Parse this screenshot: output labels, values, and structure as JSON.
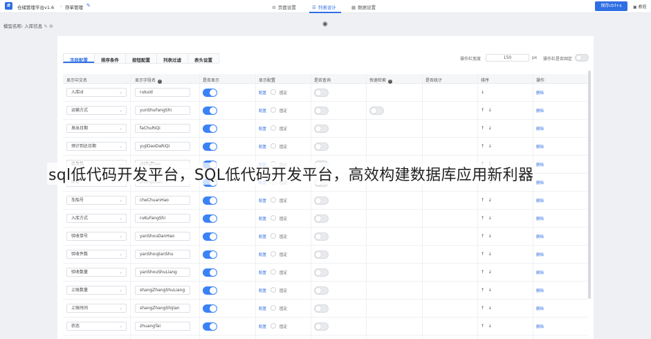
{
  "topbar": {
    "app_title": "仓储管理平台v1.6",
    "separator": "›",
    "page": "存单管理",
    "tabs": [
      {
        "label": "页面设置",
        "icon": "⚙"
      },
      {
        "label": "列表设计",
        "icon": "☰"
      },
      {
        "label": "数据设置",
        "icon": "▦"
      }
    ],
    "save_label": "保存ctrl+s",
    "help_label": "教程"
  },
  "subbar": {
    "model_label": "模型名称: 入库信息"
  },
  "config_tabs": [
    "字段配置",
    "排序条件",
    "按钮配置",
    "列表过滤",
    "表头设置"
  ],
  "options": {
    "width_label": "操作栏宽度",
    "width_value": "150",
    "unit": "px",
    "fixed_label": "操作栏是否固定"
  },
  "table": {
    "headers": [
      "显示中文名",
      "显示字段名",
      "是否显示",
      "显示配置",
      "是否查询",
      "快速检索",
      "是否统计",
      "排序",
      "操作"
    ],
    "config_link": "配置",
    "fixed_label": "固定",
    "delete_label": "删除",
    "rows": [
      {
        "cn": "入库id",
        "field": "rukuid",
        "show": true,
        "query": false,
        "quick": null,
        "arrows": "↓"
      },
      {
        "cn": "运输方式",
        "field": "yunShuFangShi",
        "show": true,
        "query": false,
        "quick": false,
        "arrows": "↑↓"
      },
      {
        "cn": "发出日期",
        "field": "faChuRiQi",
        "show": true,
        "query": false,
        "quick": null,
        "arrows": "↑↓"
      },
      {
        "cn": "预计到达日期",
        "field": "yuJiDaoDaRiQi",
        "show": true,
        "query": false,
        "quick": null,
        "arrows": "↑↓"
      },
      {
        "cn": "始发站",
        "field": "shiFaZhan",
        "show": true,
        "query": false,
        "quick": null,
        "arrows": "↑↓"
      },
      {
        "cn": "终点",
        "field": "zhongDian",
        "show": true,
        "query": false,
        "quick": null,
        "arrows": "↑↓"
      },
      {
        "cn": "车船号",
        "field": "cheChuanHao",
        "show": true,
        "query": false,
        "quick": null,
        "arrows": "↑↓"
      },
      {
        "cn": "入库方式",
        "field": "ruKuFangShi",
        "show": true,
        "query": false,
        "quick": null,
        "arrows": "↑↓"
      },
      {
        "cn": "验收单号",
        "field": "yanShouDanHao",
        "show": true,
        "query": false,
        "quick": null,
        "arrows": "↑↓"
      },
      {
        "cn": "验收件数",
        "field": "yanShouJianShu",
        "show": true,
        "query": false,
        "quick": null,
        "arrows": "↑↓"
      },
      {
        "cn": "验收数量",
        "field": "yanShouShuLiang",
        "show": true,
        "query": false,
        "quick": null,
        "arrows": "↑↓"
      },
      {
        "cn": "上账数量",
        "field": "shangZhangShuLiang",
        "show": true,
        "query": false,
        "quick": null,
        "arrows": "↑↓"
      },
      {
        "cn": "上账时间",
        "field": "shangZhangShiJian",
        "show": true,
        "query": false,
        "quick": null,
        "arrows": "↑↓"
      },
      {
        "cn": "状态",
        "field": "zhuangTai",
        "show": true,
        "query": false,
        "quick": null,
        "arrows": "↑↓"
      }
    ]
  },
  "watermark": "sql低代码开发平台，SQL低代码开发平台，高效构建数据库应用新利器"
}
